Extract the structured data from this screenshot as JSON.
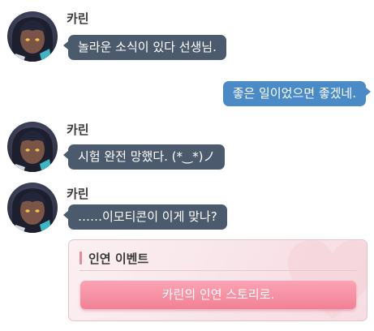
{
  "messages": [
    {
      "sender": "카린",
      "text": "놀라운 소식이 있다 선생님."
    },
    {
      "text": "좋은 일이었으면 좋겠네."
    },
    {
      "sender": "카린",
      "text": "시험 완전 망했다. (*‿*)ノ"
    },
    {
      "sender": "카린",
      "text": "……이모티콘이 이게 맞나?"
    }
  ],
  "event": {
    "title": "인연 이벤트",
    "button_label": "카린의 인연 스토리로."
  },
  "colors": {
    "npc_bubble": "#4c5a6e",
    "player_bubble": "#4a8ac6",
    "event_button": "#f28096",
    "event_card_bg": "#f8e3e8"
  },
  "icons": {
    "avatar": "karin-portrait-avatar",
    "event_bg": "heart-icon"
  }
}
